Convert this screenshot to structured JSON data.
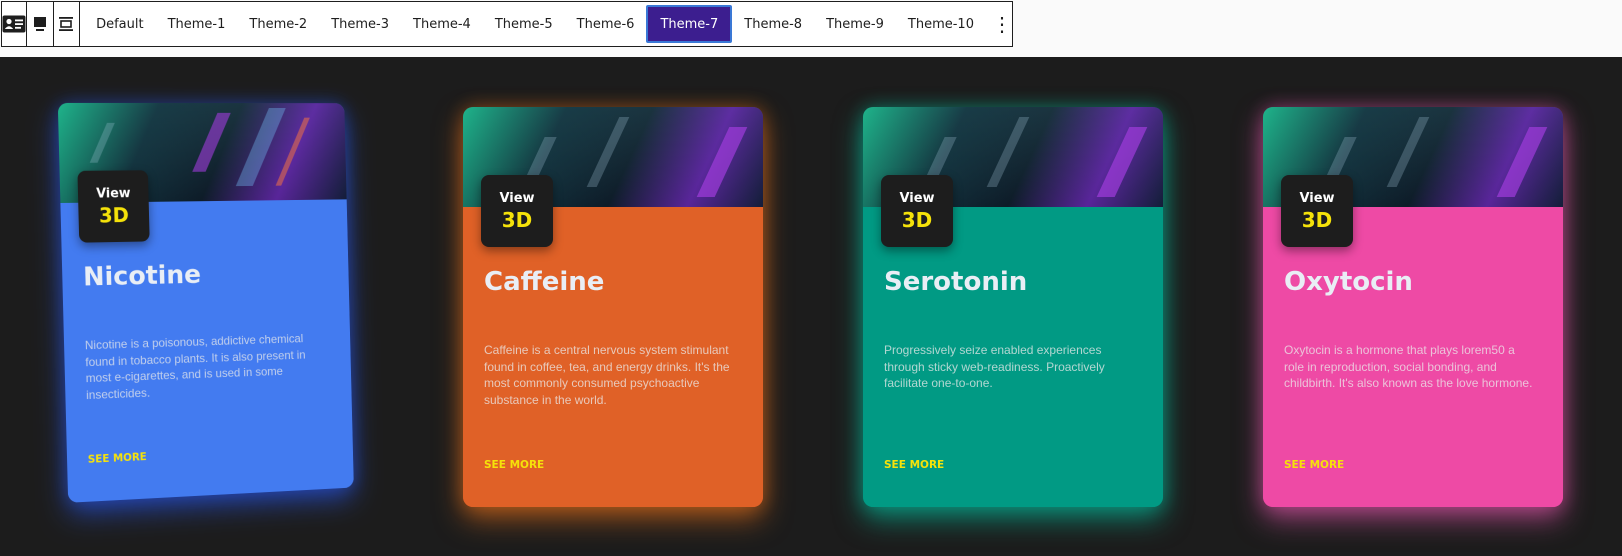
{
  "toolbar": {
    "tabs": [
      "Default",
      "Theme-1",
      "Theme-2",
      "Theme-3",
      "Theme-4",
      "Theme-5",
      "Theme-6",
      "Theme-7",
      "Theme-8",
      "Theme-9",
      "Theme-10"
    ],
    "active_tab": "Theme-7",
    "more_symbol": "⋮",
    "icons": [
      "contact-card-icon",
      "block-layout-icon",
      "align-center-icon",
      "more-vertical-icon"
    ]
  },
  "cards": [
    {
      "badge_top": "View",
      "badge_bottom": "3D",
      "title": "Nicotine",
      "description": "Nicotine is a poisonous, addictive chemical found in tobacco plants. It is also present in most e-cigarettes, and is used in some insecticides.",
      "link": "SEE MORE",
      "color": "#437bf0",
      "glow": "#2a5cff"
    },
    {
      "badge_top": "View",
      "badge_bottom": "3D",
      "title": "Caffeine",
      "description": "Caffeine is a central nervous system stimulant found in coffee, tea, and energy drinks. It's the most commonly consumed psychoactive substance in the world.",
      "link": "SEE MORE",
      "color": "#e06127",
      "glow": "#ff7a1a"
    },
    {
      "badge_top": "View",
      "badge_bottom": "3D",
      "title": "Serotonin",
      "description": "Progressively seize enabled experiences through sticky web-readiness. Proactively facilitate one-to-one.",
      "link": "SEE MORE",
      "color": "#019a84",
      "glow": "#00d4b0"
    },
    {
      "badge_top": "View",
      "badge_bottom": "3D",
      "title": "Oxytocin",
      "description": "Oxytocin is a hormone that plays lorem50 a role in reproduction, social bonding, and childbirth. It's also known as the love hormone.",
      "link": "SEE MORE",
      "color": "#ee4aa5",
      "glow": "#ff5ec0"
    }
  ],
  "colors": {
    "stage_background": "#1c1c1c",
    "active_tab_bg": "#3c1e8f",
    "accent_yellow": "#f5e20a"
  }
}
